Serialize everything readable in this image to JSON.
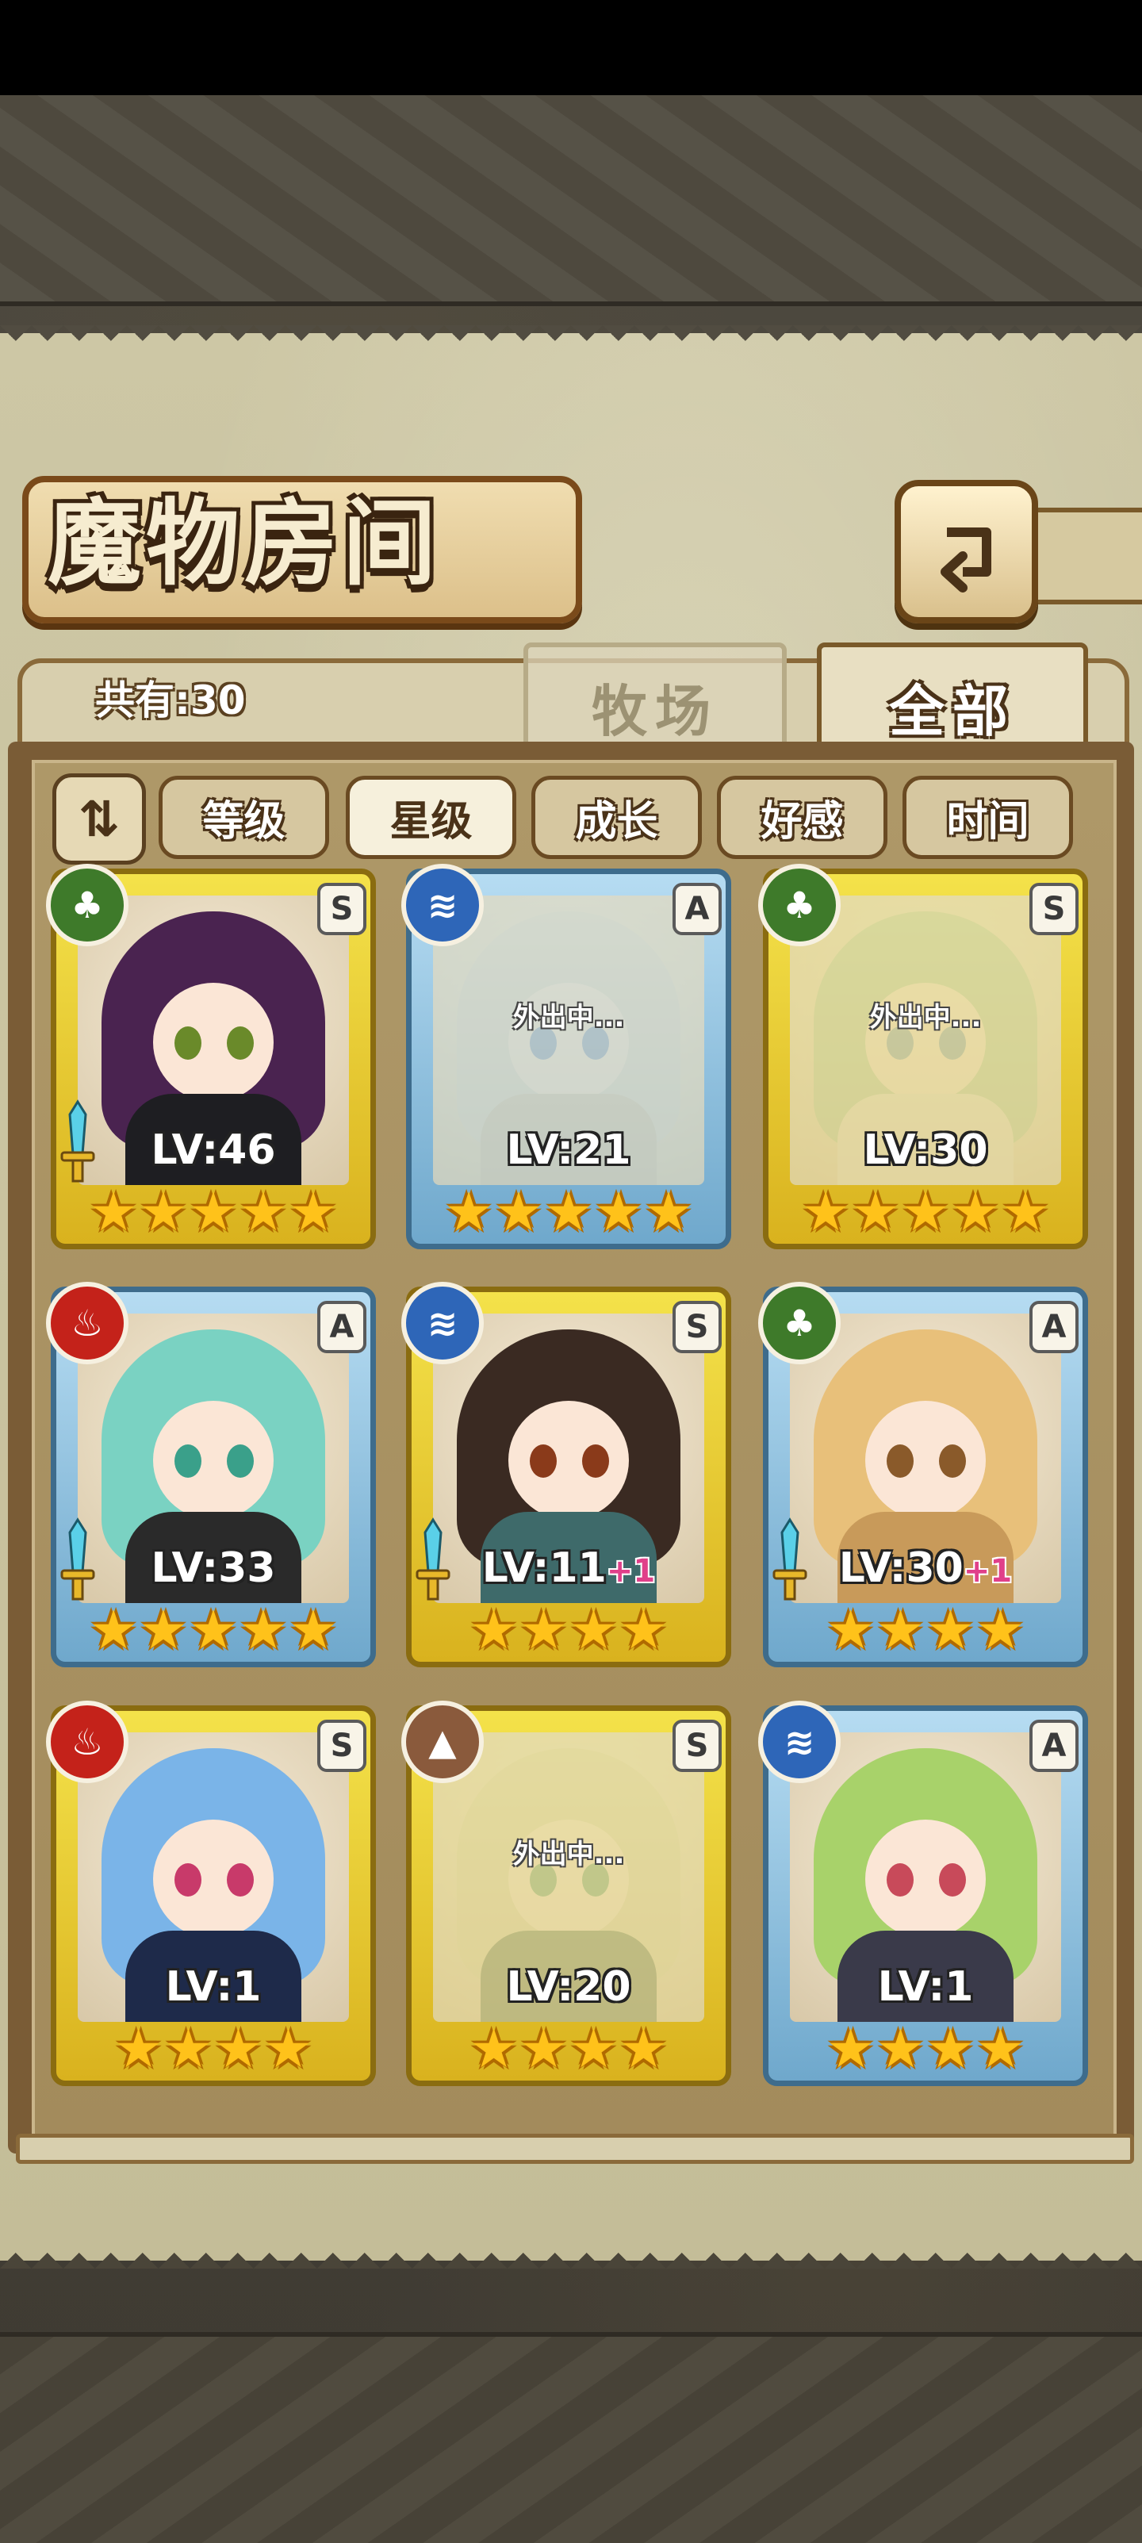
{
  "title": "魔物房间",
  "count_label": "共有:30",
  "tabs": {
    "ranch": "牧场",
    "all": "全部"
  },
  "sort": {
    "toggle_icon": "sort-order-icon",
    "buttons": [
      "等级",
      "星级",
      "成长",
      "好感",
      "时间"
    ],
    "active": "星级"
  },
  "away_text": "外出中...",
  "monsters": [
    {
      "frame": "gold",
      "element": "leaf",
      "rank": "S",
      "level": "LV:46",
      "bonus": "",
      "stars": 5,
      "away": false,
      "sword": true,
      "hair": "#4a2350",
      "body": "#1e1e22",
      "eye": "#6a8a2a"
    },
    {
      "frame": "blue",
      "element": "water",
      "rank": "A",
      "level": "LV:21",
      "bonus": "",
      "stars": 5,
      "away": true,
      "sword": false,
      "hair": "#d8d2c4",
      "body": "#c8b8a0",
      "eye": "#4a7ab8"
    },
    {
      "frame": "gold",
      "element": "leaf",
      "rank": "S",
      "level": "LV:30",
      "bonus": "",
      "stars": 5,
      "away": true,
      "sword": false,
      "hair": "#a4c89a",
      "body": "#e8e2d4",
      "eye": "#5a8ab0"
    },
    {
      "frame": "blue",
      "element": "fire",
      "rank": "A",
      "level": "LV:33",
      "bonus": "",
      "stars": 5,
      "away": false,
      "sword": true,
      "hair": "#7ad2c2",
      "body": "#2a2a2a",
      "eye": "#3aa08a"
    },
    {
      "frame": "gold",
      "element": "water",
      "rank": "S",
      "level": "LV:11",
      "bonus": "+1",
      "stars": 4,
      "away": false,
      "sword": true,
      "hair": "#3a2a22",
      "body": "#3e6a6a",
      "eye": "#8a3a1a"
    },
    {
      "frame": "blue",
      "element": "leaf",
      "rank": "A",
      "level": "LV:30",
      "bonus": "+1",
      "stars": 4,
      "away": false,
      "sword": true,
      "hair": "#e8c07a",
      "body": "#c89a5a",
      "eye": "#8a5a2a"
    },
    {
      "frame": "gold",
      "element": "fire",
      "rank": "S",
      "level": "LV:1",
      "bonus": "",
      "stars": 4,
      "away": false,
      "sword": false,
      "hair": "#7ab4e8",
      "body": "#1e2a4a",
      "eye": "#c83a6a"
    },
    {
      "frame": "gold",
      "element": "earth",
      "rank": "S",
      "level": "LV:20",
      "bonus": "",
      "stars": 4,
      "away": true,
      "sword": false,
      "hair": "#d8d2aa",
      "body": "#3a5a3a",
      "eye": "#3a8a5a"
    },
    {
      "frame": "blue",
      "element": "water",
      "rank": "A",
      "level": "LV:1",
      "bonus": "",
      "stars": 4,
      "away": false,
      "sword": false,
      "hair": "#a8d26a",
      "body": "#3a3a4a",
      "eye": "#c84a5a"
    }
  ]
}
